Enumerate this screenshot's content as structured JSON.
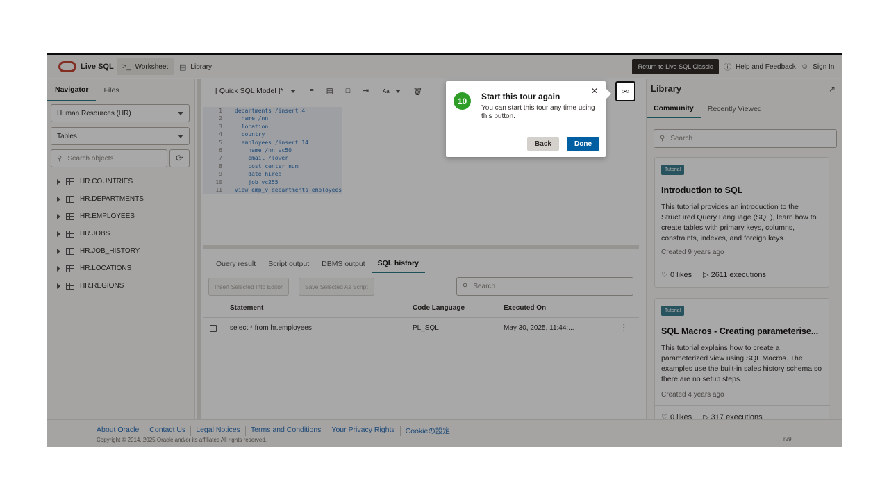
{
  "header": {
    "brand": "Live SQL",
    "worksheet": "Worksheet",
    "library": "Library",
    "classic_button": "Return to Live SQL Classic",
    "help": "Help and Feedback",
    "sign_in": "Sign In",
    "worksheet_glyph": ">_"
  },
  "navigator": {
    "tabs": [
      "Navigator",
      "Files"
    ],
    "schema": "Human Resources (HR)",
    "object_type": "Tables",
    "search_placeholder": "Search objects",
    "tables": [
      "HR.COUNTRIES",
      "HR.DEPARTMENTS",
      "HR.EMPLOYEES",
      "HR.JOBS",
      "HR.JOB_HISTORY",
      "HR.LOCATIONS",
      "HR.REGIONS"
    ]
  },
  "editor": {
    "mode": "[ Quick SQL Model ]*",
    "font_label": "Aa",
    "lines": [
      {
        "n": "1",
        "text": "departments /insert 4"
      },
      {
        "n": "2",
        "text": "  name /nn"
      },
      {
        "n": "3",
        "text": "  location"
      },
      {
        "n": "4",
        "text": "  country"
      },
      {
        "n": "5",
        "text": "  employees /insert 14"
      },
      {
        "n": "6",
        "text": "    name /nn vc50"
      },
      {
        "n": "7",
        "text": "    email /lower"
      },
      {
        "n": "8",
        "text": "    cost center num"
      },
      {
        "n": "9",
        "text": "    date hired"
      },
      {
        "n": "10",
        "text": "    job vc255"
      },
      {
        "n": "11",
        "text": "view emp_v departments employees"
      }
    ]
  },
  "results": {
    "tabs": [
      "Query result",
      "Script output",
      "DBMS output",
      "SQL history"
    ],
    "insert_btn": "Insert Selected Into Editor",
    "save_btn": "Save Selected As Script",
    "search_placeholder": "Search",
    "columns": [
      "Statement",
      "Code Language",
      "Executed On"
    ],
    "rows": [
      {
        "statement": "select * from hr.employees",
        "language": "PL_SQL",
        "executed": "May 30, 2025, 11:44:..."
      }
    ]
  },
  "library": {
    "title": "Library",
    "tabs": [
      "Community",
      "Recently Viewed"
    ],
    "search_placeholder": "Search",
    "cards": [
      {
        "badge": "Tutorial",
        "title": "Introduction to SQL",
        "desc": "This tutorial provides an introduction to the Structured Query Language (SQL), learn how to create tables with primary keys, columns, constraints, indexes, and foreign keys.",
        "created": "Created 9 years ago",
        "likes": "0 likes",
        "executions": "2611 executions"
      },
      {
        "badge": "Tutorial",
        "title": "SQL Macros - Creating parameterise...",
        "desc": "This tutorial explains how to create a parameterized view using SQL Macros. The examples use the built-in sales history schema so there are no setup steps.",
        "created": "Created 4 years ago",
        "likes": "0 likes",
        "executions": "317 executions"
      }
    ]
  },
  "footer": {
    "links": [
      "About Oracle",
      "Contact Us",
      "Legal Notices",
      "Terms and Conditions",
      "Your Privacy Rights",
      "Cookieの設定"
    ],
    "copyright": "Copyright © 2014, 2025 Oracle and/or its affiliates All rights reserved.",
    "version": "r29"
  },
  "tour": {
    "step": "10",
    "title": "Start this tour again",
    "text": "You can start this tour any time using this button.",
    "back": "Back",
    "done": "Done"
  },
  "colors": {
    "accent": "#2a7b85",
    "done_button": "#005fa3",
    "step_badge": "#2f9e28",
    "oracle_red": "#c74634"
  }
}
